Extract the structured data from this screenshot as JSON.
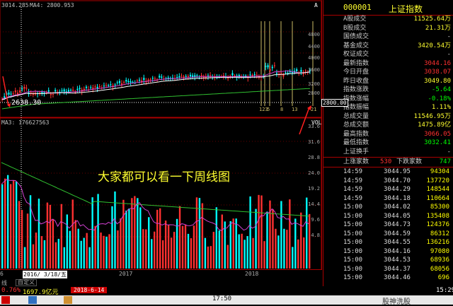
{
  "chart": {
    "ma_label_top": "3014.285",
    "ma4_label": "MA4: 2800.953",
    "top_right_mark": "A",
    "low_price_label": "2638.30",
    "right_axis": [
      "4800",
      "4400",
      "4000",
      "3600",
      "3200",
      "2800"
    ],
    "current_price_tag": "2800.00",
    "vol_label": "MA3: 176627563",
    "vol_right_mark": "VOL",
    "vol_axis": [
      "33.6",
      "31.6",
      "28.8",
      "24.0",
      "19.2",
      "14.4",
      "9.6",
      "4.8"
    ],
    "vline_labels": [
      "123",
      "5",
      "8",
      "13",
      "21"
    ],
    "overlay_text": "大家都可以看一下周线图",
    "bottom_axis": [
      "6",
      "2016/ 3/18/五",
      "2017",
      "2018"
    ],
    "bottom_tabs": [
      "线",
      "自定义"
    ]
  },
  "side": {
    "title_code": "000001",
    "title_name": "上证指数",
    "rows": [
      {
        "label": "A股成交",
        "value": "11525.64万"
      },
      {
        "label": "B股成交",
        "value": "21.31万"
      },
      {
        "label": "国债成交",
        "value": "-"
      },
      {
        "label": "基金成交",
        "value": "3420.54万"
      },
      {
        "label": "权证成交",
        "value": "-"
      },
      {
        "label": "最新指数",
        "value": "3044.16"
      },
      {
        "label": "今日开盘",
        "value": "3038.07"
      },
      {
        "label": "昨日收盘",
        "value": "3049.80"
      },
      {
        "label": "指数涨跌",
        "value": "-5.64"
      },
      {
        "label": "指数涨幅",
        "value": "-0.18%"
      },
      {
        "label": "指数振幅",
        "value": "1.11%"
      },
      {
        "label": "总成交量",
        "value": "11546.95万"
      },
      {
        "label": "总成交额",
        "value": "1475.89亿"
      },
      {
        "label": "最高指数",
        "value": "3066.05"
      },
      {
        "label": "最低指数",
        "value": "3032.41"
      },
      {
        "label": "上证换手",
        "value": "-"
      }
    ],
    "updown": {
      "up_label": "上涨家数",
      "up": "530",
      "down_label": "下跌家数",
      "down": "747"
    },
    "ticks": [
      {
        "t": "14:59",
        "p": "3044.95",
        "v": "94304"
      },
      {
        "t": "14:59",
        "p": "3044.70",
        "v": "137720"
      },
      {
        "t": "14:59",
        "p": "3044.29",
        "v": "148544"
      },
      {
        "t": "14:59",
        "p": "3044.18",
        "v": "110664"
      },
      {
        "t": "15:00",
        "p": "3044.02",
        "v": "85300"
      },
      {
        "t": "15:00",
        "p": "3044.05",
        "v": "135408"
      },
      {
        "t": "15:00",
        "p": "3044.73",
        "v": "124376"
      },
      {
        "t": "15:00",
        "p": "3044.59",
        "v": "86312"
      },
      {
        "t": "15:00",
        "p": "3044.55",
        "v": "136216"
      },
      {
        "t": "15:00",
        "p": "3044.16",
        "v": "97080"
      },
      {
        "t": "15:00",
        "p": "3044.53",
        "v": "68936"
      },
      {
        "t": "15:00",
        "p": "3044.37",
        "v": "68056"
      },
      {
        "t": "15:00",
        "p": "3044.46",
        "v": "696"
      }
    ]
  },
  "status": {
    "pct": "0.76%",
    "amount": "1697.9亿元",
    "date": "2018-6-14",
    "time": "17:50",
    "watermark": "股神洗股",
    "time2": "15:29"
  },
  "colors": {
    "up": "#ff3030",
    "down": "#00ffff",
    "ma": "#ffffff",
    "yellow": "#ffff00"
  }
}
